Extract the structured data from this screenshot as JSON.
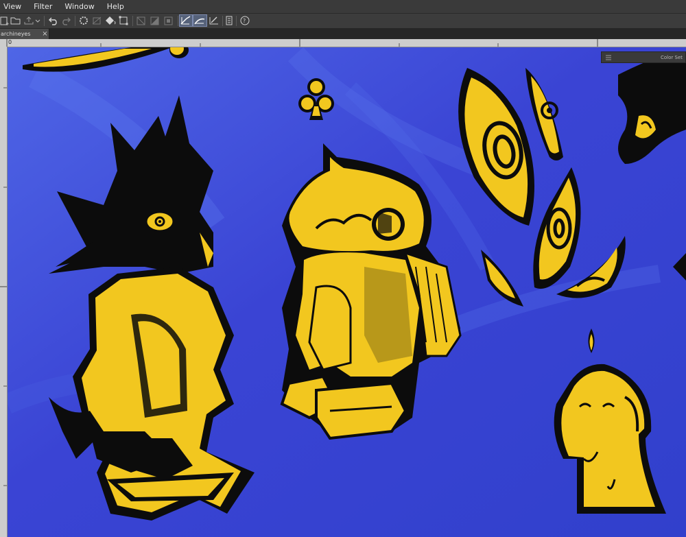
{
  "menu": {
    "view": "View",
    "filter": "Filter",
    "window": "Window",
    "help": "Help"
  },
  "document_tab": {
    "title": "archineyes",
    "close": "×"
  },
  "ruler": {
    "origin_label": "0"
  },
  "color_set_panel": {
    "title": "Color Set"
  },
  "colors": {
    "canvas_blue": "#3a45d6",
    "character_yellow": "#f2c71f",
    "ink_black": "#0c0c0c"
  }
}
